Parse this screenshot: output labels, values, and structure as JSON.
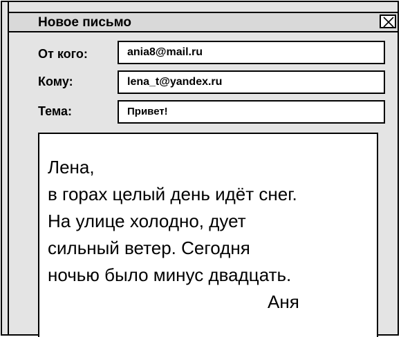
{
  "window": {
    "title": "Новое письмо",
    "close_icon": "close-x-icon"
  },
  "header_fields": {
    "from_label": "От кого:",
    "from_value": "ania8@mail.ru",
    "to_label": "Кому:",
    "to_value": "lena_t@yandex.ru",
    "subject_label": "Тема:",
    "subject_value": "Привет!"
  },
  "message": {
    "lines": [
      "Лена,",
      "в горах целый день идёт снег.",
      "На улице холодно, дует",
      "сильный ветер. Сегодня",
      "ночью было минус двадцать."
    ],
    "signature": "Аня"
  }
}
